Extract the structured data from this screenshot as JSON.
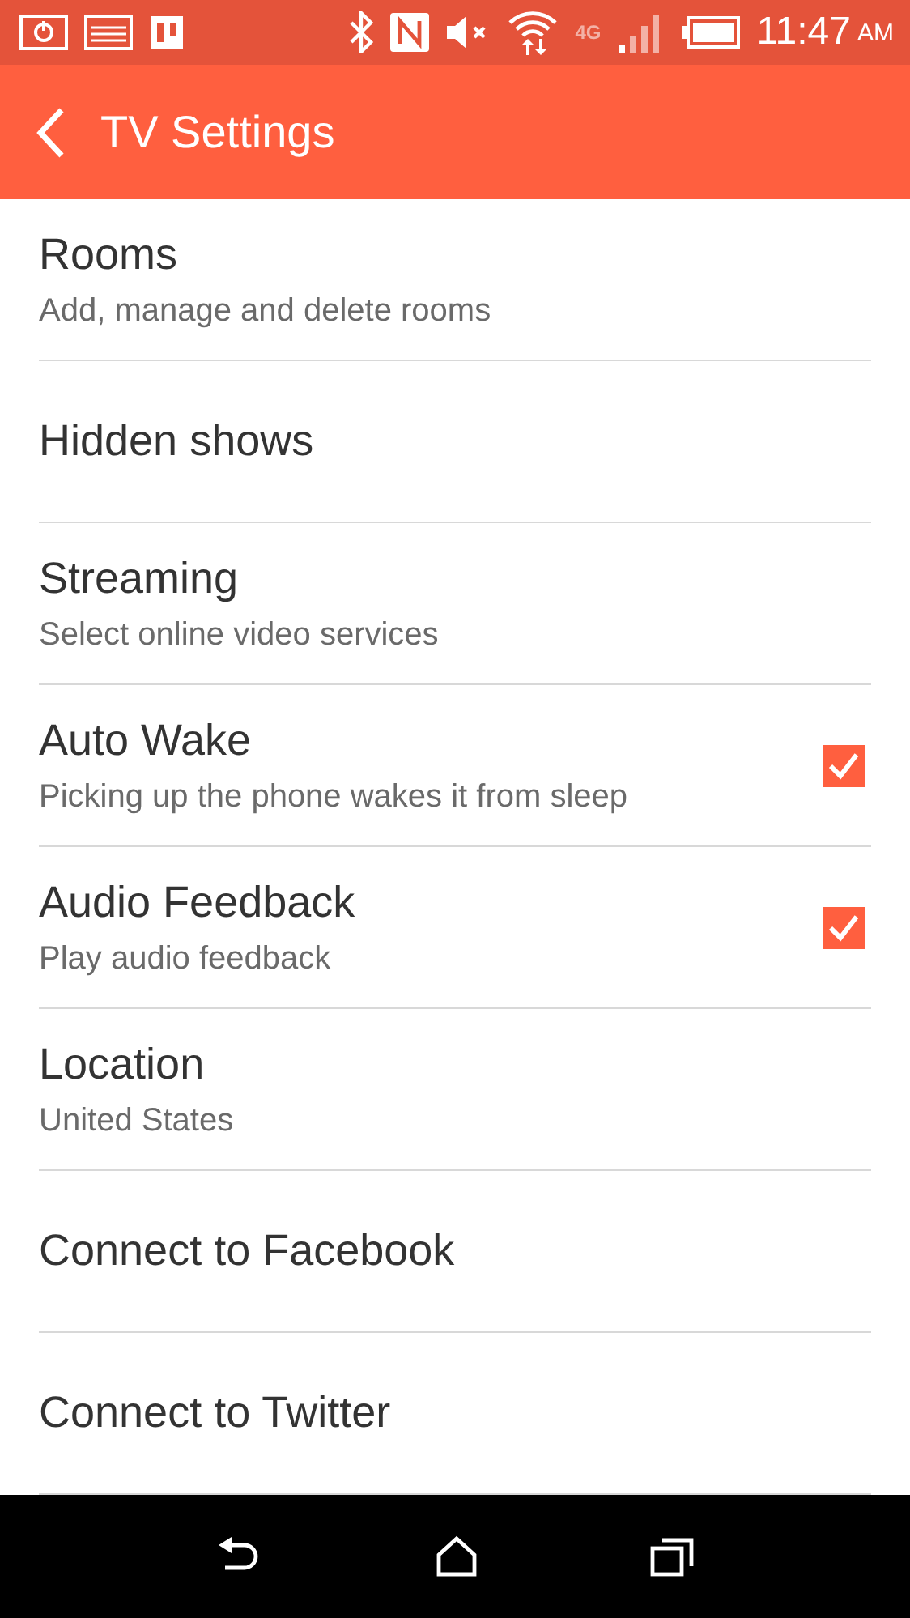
{
  "status_bar": {
    "wifi_label": "4G",
    "time": "11:47",
    "meridiem": "AM"
  },
  "app_bar": {
    "title": "TV Settings"
  },
  "settings": [
    {
      "kind": "nav",
      "title": "Rooms",
      "subtitle": "Add, manage and delete rooms"
    },
    {
      "kind": "nav",
      "title": "Hidden shows"
    },
    {
      "kind": "nav",
      "title": "Streaming",
      "subtitle": "Select online video services"
    },
    {
      "kind": "checkbox",
      "title": "Auto Wake",
      "subtitle": "Picking up the phone wakes it from sleep",
      "checked": true
    },
    {
      "kind": "checkbox",
      "title": "Audio Feedback",
      "subtitle": "Play audio feedback",
      "checked": true
    },
    {
      "kind": "nav",
      "title": "Location",
      "subtitle": "United States"
    },
    {
      "kind": "nav",
      "title": "Connect to Facebook"
    },
    {
      "kind": "nav",
      "title": "Connect to Twitter"
    }
  ]
}
